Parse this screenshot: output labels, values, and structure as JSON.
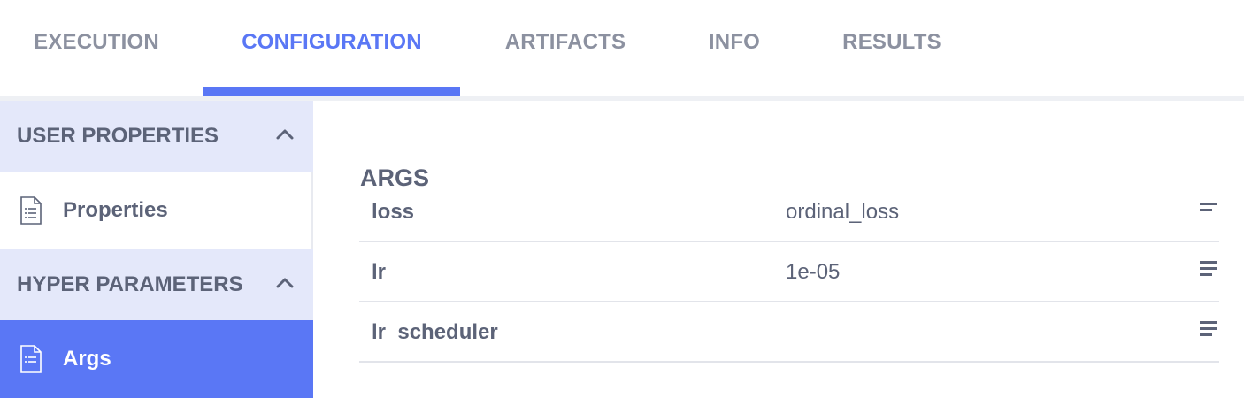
{
  "tabs": [
    {
      "label": "EXECUTION",
      "active": false
    },
    {
      "label": "CONFIGURATION",
      "active": true
    },
    {
      "label": "ARTIFACTS",
      "active": false
    },
    {
      "label": "INFO",
      "active": false
    },
    {
      "label": "RESULTS",
      "active": false
    }
  ],
  "sidebar": {
    "user_properties": {
      "header": "USER PROPERTIES",
      "icon": "chevron-up-icon",
      "items": [
        {
          "label": "Properties",
          "icon": "document-list-icon"
        }
      ]
    },
    "hyper_parameters": {
      "header": "HYPER PARAMETERS",
      "icon": "chevron-up-icon",
      "items": [
        {
          "label": "Args",
          "icon": "document-list-icon",
          "active": true
        }
      ]
    }
  },
  "main": {
    "section_title": "ARGS",
    "rows": [
      {
        "key": "loss",
        "value": "ordinal_loss"
      },
      {
        "key": "lr",
        "value": "1e-05"
      },
      {
        "key": "lr_scheduler",
        "value": ""
      }
    ]
  },
  "colors": {
    "accent": "#5a77f5",
    "section_header_bg": "#e4e8fa",
    "text": "#5c6378",
    "inactive_tab": "#8c91a0"
  }
}
